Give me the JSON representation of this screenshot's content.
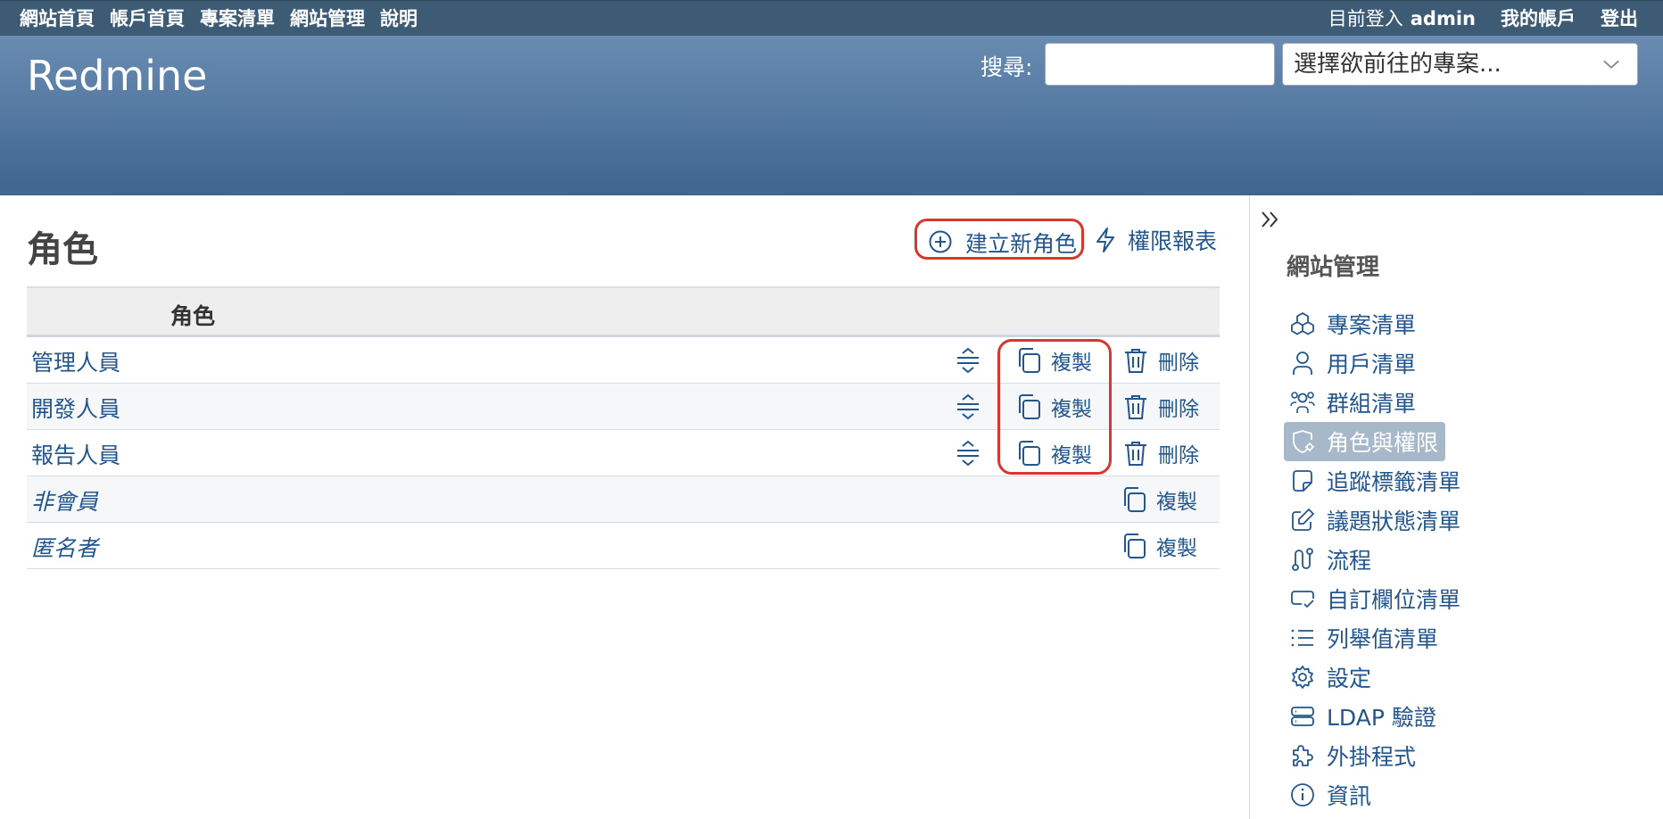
{
  "top_menu": {
    "left": [
      "網站首頁",
      "帳戶首頁",
      "專案清單",
      "網站管理",
      "說明"
    ],
    "logged_in_label": "目前登入",
    "user": "admin",
    "my_account": "我的帳戶",
    "logout": "登出"
  },
  "header": {
    "site_title": "Redmine",
    "search_label": "搜尋:",
    "search_value": "",
    "project_select": "選擇欲前往的專案..."
  },
  "main": {
    "title": "角色",
    "actions": {
      "new_role": "建立新角色",
      "permissions_report": "權限報表"
    },
    "table": {
      "column_header": "角色",
      "rows": [
        {
          "name": "管理人員",
          "sortable": true,
          "copy": "複製",
          "delete": "刪除"
        },
        {
          "name": "開發人員",
          "sortable": true,
          "copy": "複製",
          "delete": "刪除"
        },
        {
          "name": "報告人員",
          "sortable": true,
          "copy": "複製",
          "delete": "刪除"
        },
        {
          "name": "非會員",
          "builtin": true,
          "copy": "複製"
        },
        {
          "name": "匿名者",
          "builtin": true,
          "copy": "複製"
        }
      ]
    }
  },
  "sidebar": {
    "title": "網站管理",
    "items": [
      {
        "label": "專案清單",
        "icon": "projects-icon"
      },
      {
        "label": "用戶清單",
        "icon": "user-icon"
      },
      {
        "label": "群組清單",
        "icon": "group-icon"
      },
      {
        "label": "角色與權限",
        "icon": "shield-icon",
        "active": true
      },
      {
        "label": "追蹤標籤清單",
        "icon": "note-icon"
      },
      {
        "label": "議題狀態清單",
        "icon": "edit-icon"
      },
      {
        "label": "流程",
        "icon": "workflow-icon"
      },
      {
        "label": "自訂欄位清單",
        "icon": "custom-field-icon"
      },
      {
        "label": "列舉值清單",
        "icon": "list-icon"
      },
      {
        "label": "設定",
        "icon": "gear-icon"
      },
      {
        "label": "LDAP 驗證",
        "icon": "server-icon"
      },
      {
        "label": "外掛程式",
        "icon": "puzzle-icon"
      },
      {
        "label": "資訊",
        "icon": "info-icon"
      }
    ]
  },
  "colors": {
    "link": "#23568d",
    "top_bar": "#3e5b76",
    "header": "#628db6",
    "highlight": "#d9372e"
  }
}
